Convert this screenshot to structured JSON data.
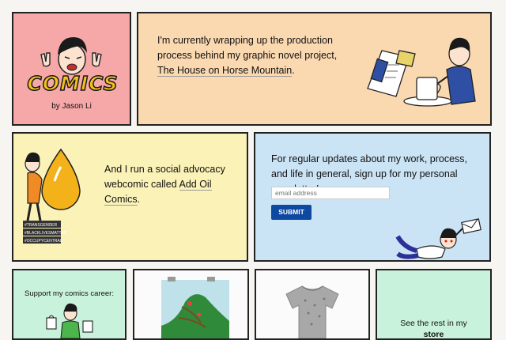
{
  "logo_panel": {
    "logo_text": "COMICS",
    "byline": "by Jason Li"
  },
  "novel_panel": {
    "text_before_link": "I'm currently wrapping up the production process behind my graphic novel project, ",
    "link_text": "The House on Horse Mountain",
    "text_after_link": "."
  },
  "advocacy_panel": {
    "text_before_link": "And I run a social advocacy webcomic called ",
    "link_text": "Add Oil Comics",
    "text_after_link": ".",
    "book_labels": [
      "#TRANSGENDER",
      "#BLACKLIVESMATTER",
      "#OCCUPYCENTRAL"
    ]
  },
  "newsletter_panel": {
    "text": "For regular updates about my work, process, and life in general, sign up for my personal newsletter!",
    "email_placeholder": "email address",
    "submit_label": "SUBMIT"
  },
  "support_panel": {
    "text": "Support my comics career:"
  },
  "store_panel": {
    "text": "See the rest in my",
    "link_text": "store"
  },
  "colors": {
    "logo_bg": "#f6a8a8",
    "novel_bg": "#fad8b0",
    "advocacy_bg": "#fbf2b8",
    "newsletter_bg": "#cbe4f5",
    "support_bg": "#c9f2dc",
    "submit_bg": "#0d49a0"
  }
}
